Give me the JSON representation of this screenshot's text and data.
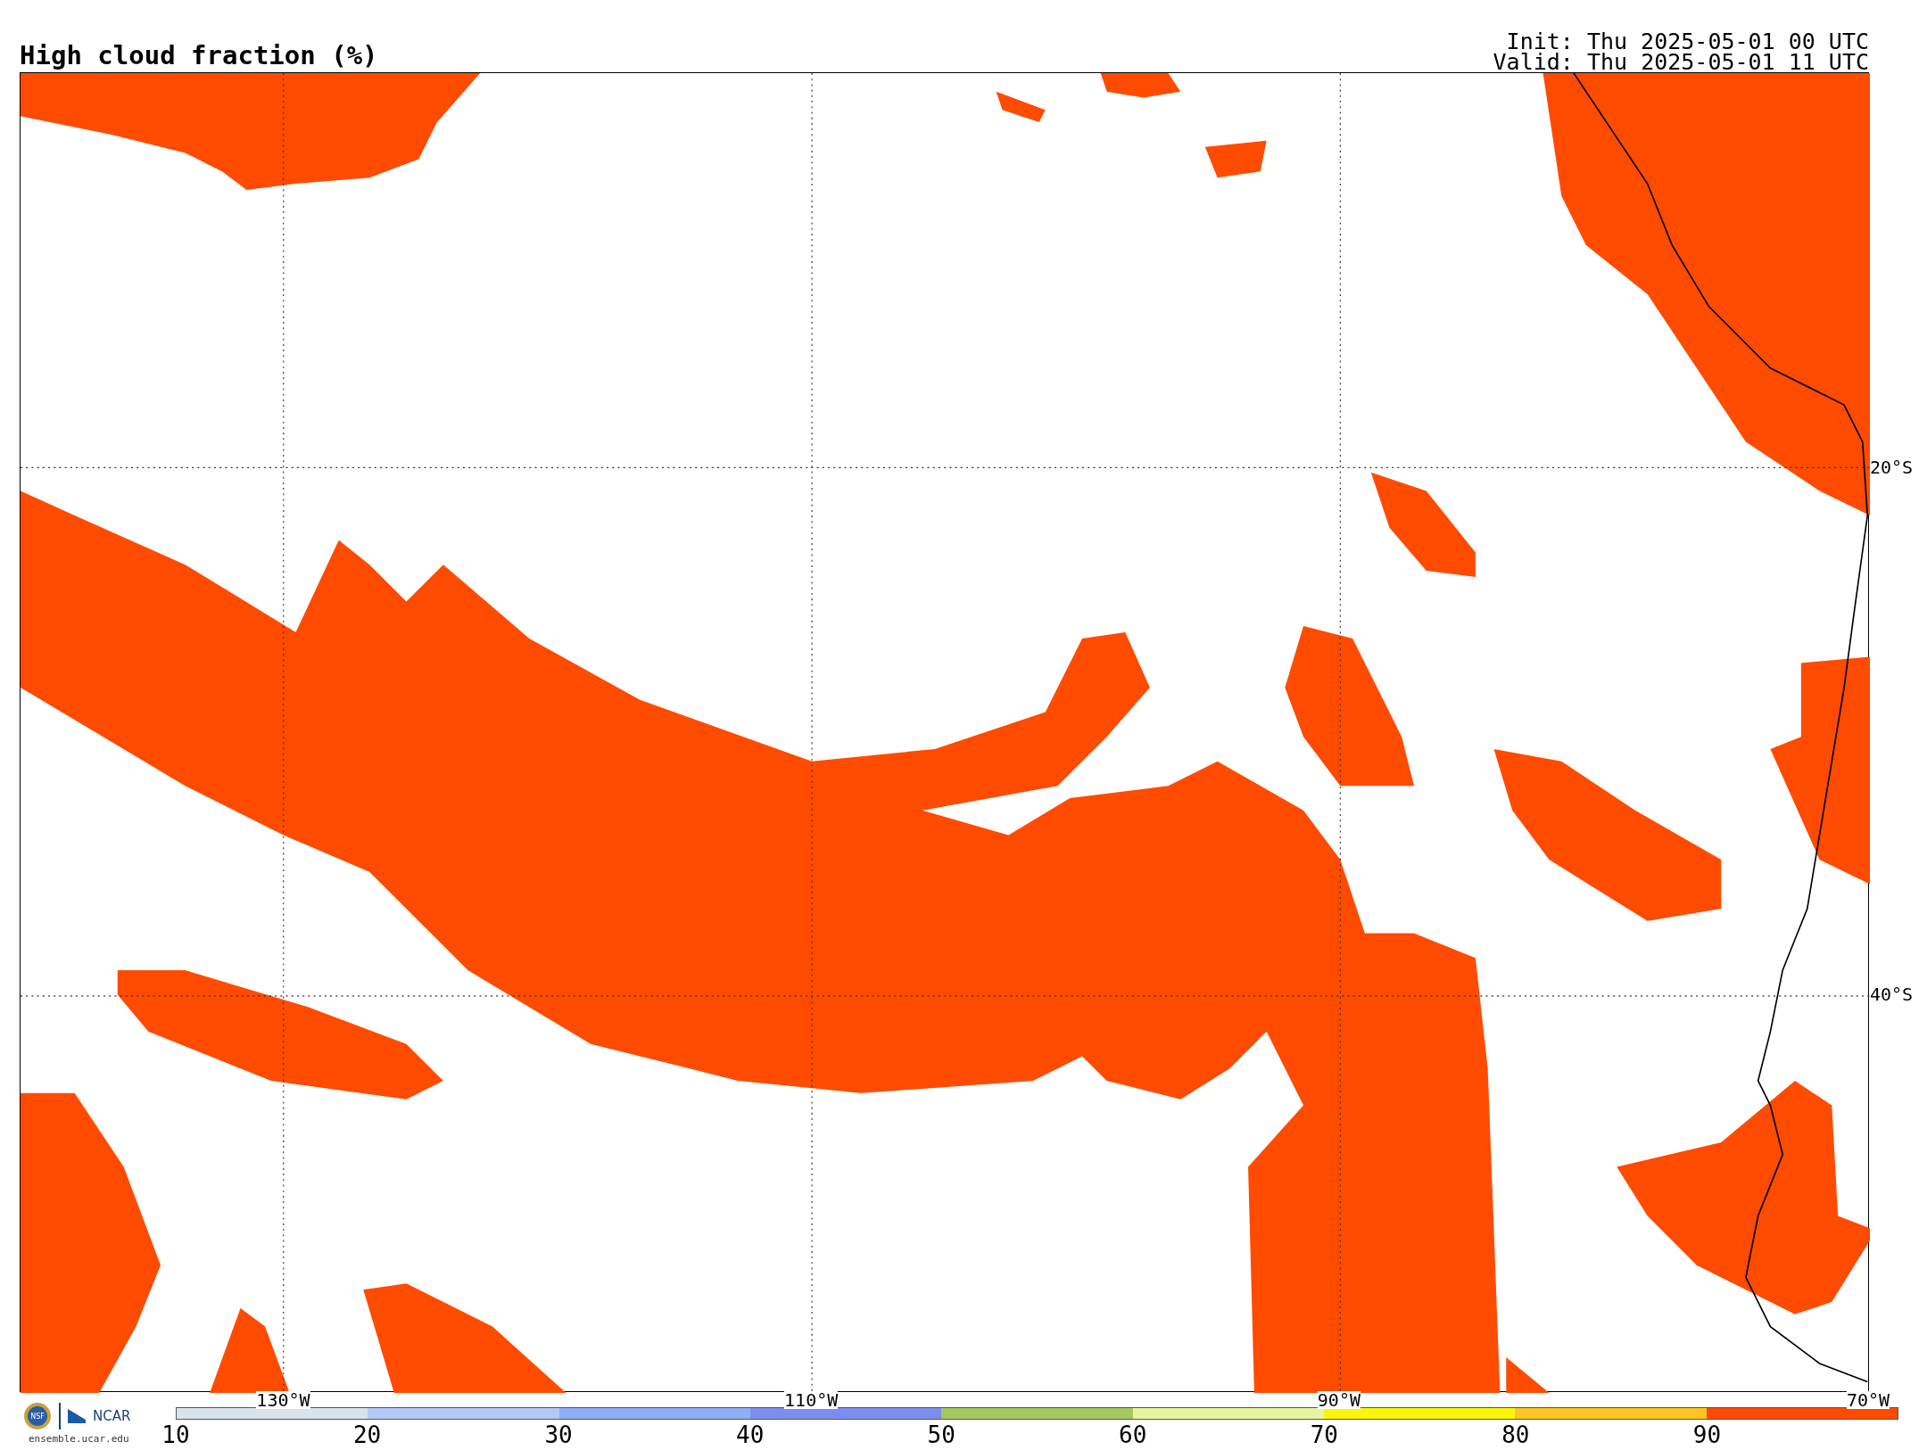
{
  "title": "High cloud fraction (%)",
  "init": "Init: Thu 2025-05-01 00 UTC",
  "valid": "Valid: Thu 2025-05-01 11 UTC",
  "map": {
    "lon_labels": [
      "130°W",
      "110°W",
      "90°W",
      "70°W"
    ],
    "lat_labels": [
      "20°S",
      "40°S"
    ]
  },
  "logos": {
    "nsf": "NSF",
    "ncar": "NCAR",
    "url": "ensemble.ucar.edu"
  },
  "colorbar": {
    "bins": [
      {
        "label": "10",
        "color": "#d9e3ec"
      },
      {
        "label": "20",
        "color": "#b4c8f5"
      },
      {
        "label": "30",
        "color": "#8eaef5"
      },
      {
        "label": "40",
        "color": "#7b8ef0"
      },
      {
        "label": "50",
        "color": "#a5c85f"
      },
      {
        "label": "60",
        "color": "#e6f5a0"
      },
      {
        "label": "70",
        "color": "#fbf50a"
      },
      {
        "label": "80",
        "color": "#fcc524"
      },
      {
        "label": "90",
        "color": "#ff4b00"
      }
    ]
  }
}
